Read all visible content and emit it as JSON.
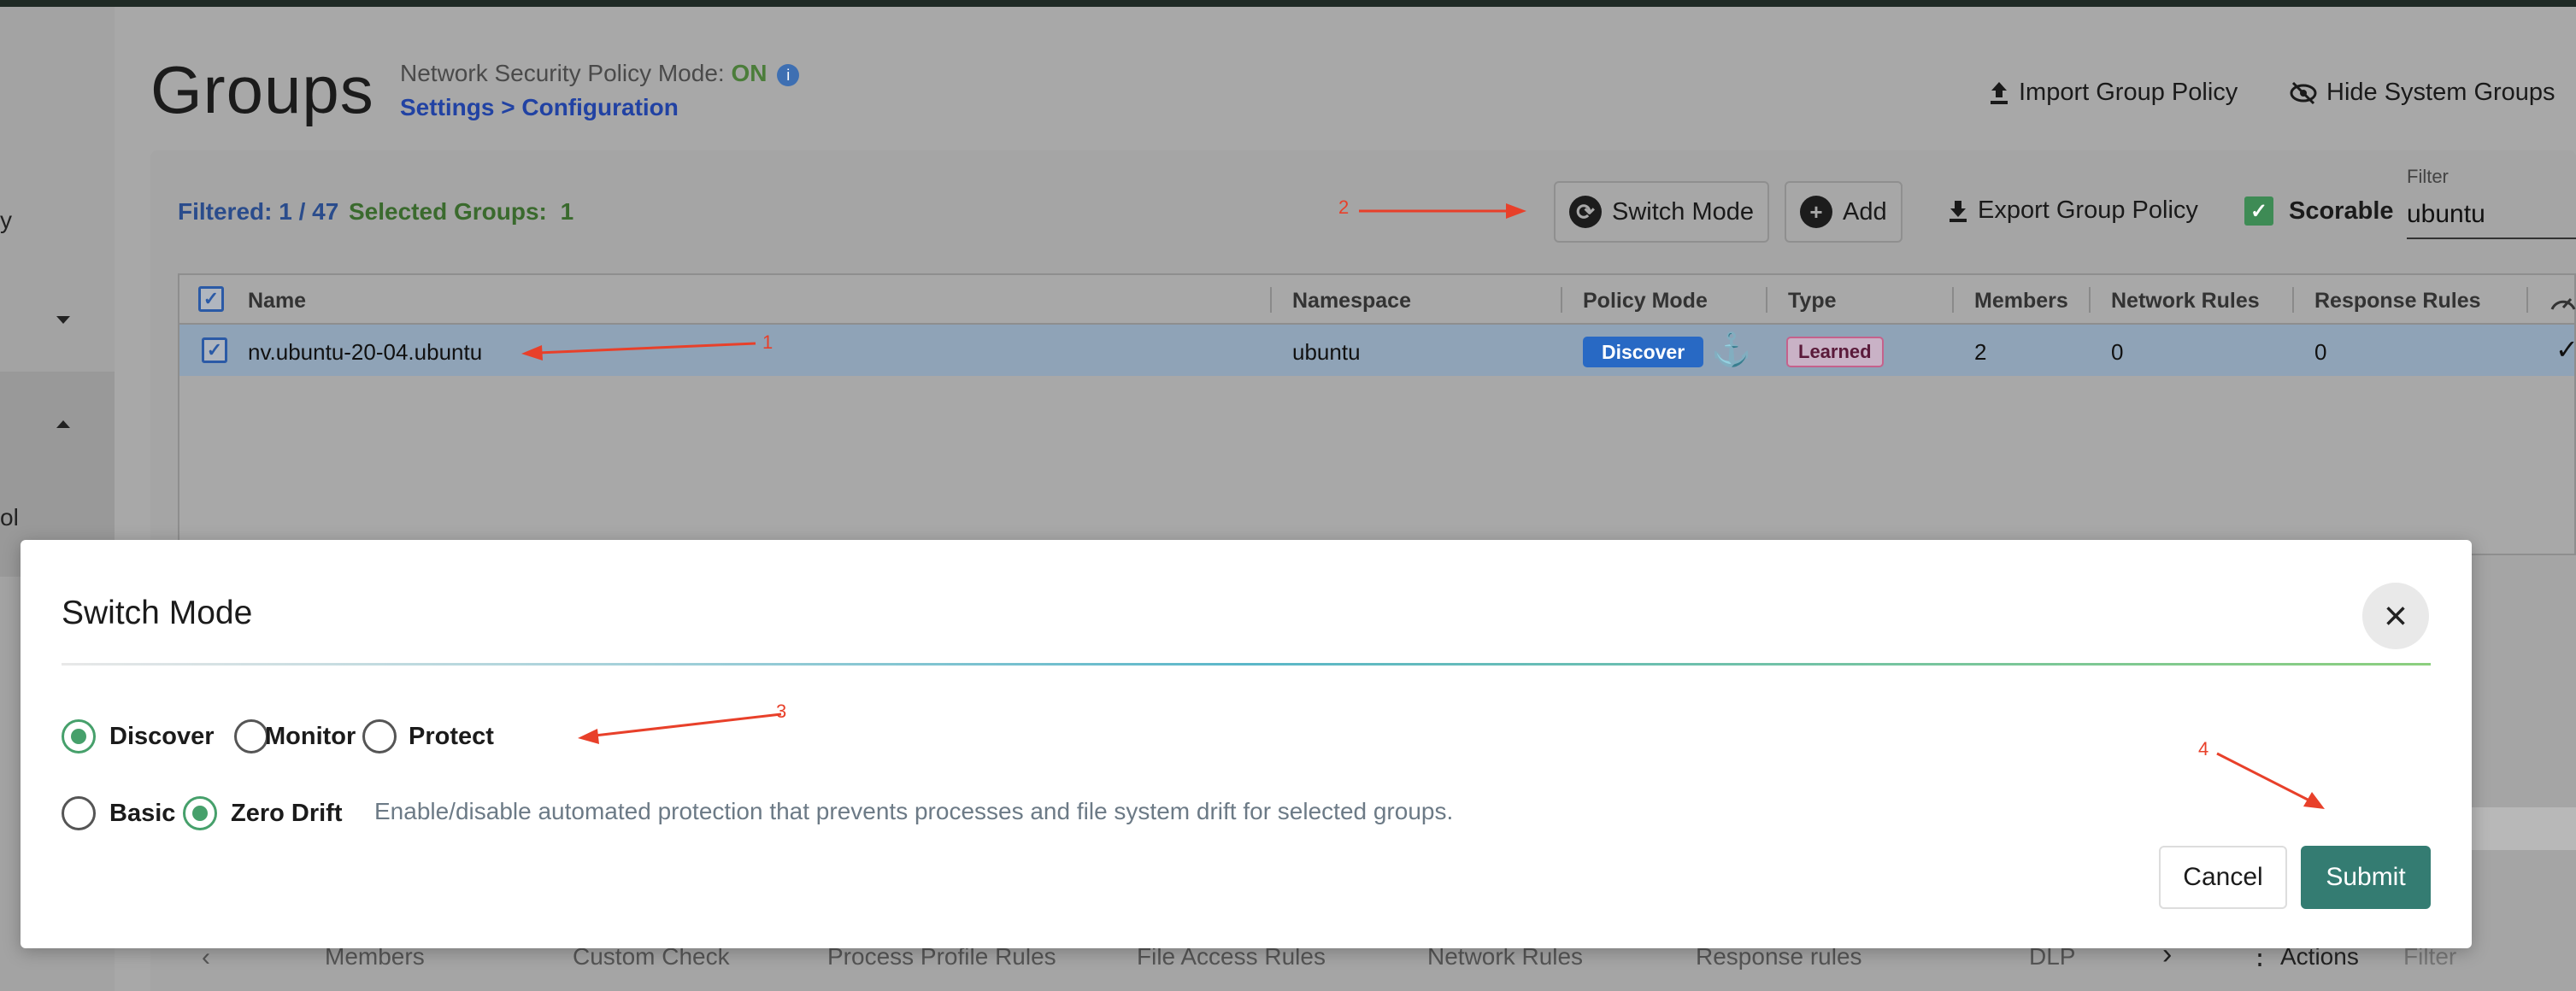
{
  "leftnav": {
    "fragments": [
      "y",
      "ol"
    ]
  },
  "page": {
    "title": "Groups",
    "mode_label": "Network Security Policy Mode:",
    "mode_value": "ON",
    "info_icon": "i",
    "settings_link": "Settings > Configuration",
    "import_label": "Import Group Policy",
    "hide_system_label": "Hide System Groups"
  },
  "toolbar": {
    "filtered_label": "Filtered: 1 / 47",
    "selected_label": "Selected Groups:",
    "selected_count": "1",
    "switch_mode_label": "Switch Mode",
    "add_label": "Add",
    "export_label": "Export Group Policy",
    "scorable_label": "Scorable",
    "filter_label": "Filter",
    "filter_value": "ubuntu"
  },
  "table": {
    "columns": [
      "Name",
      "Namespace",
      "Policy Mode",
      "Type",
      "Members",
      "Network Rules",
      "Response Rules"
    ],
    "rows": [
      {
        "name": "nv.ubuntu-20-04.ubuntu",
        "namespace": "ubuntu",
        "policy_mode": "Discover",
        "type": "Learned",
        "members": "2",
        "network_rules": "0",
        "response_rules": "0"
      }
    ]
  },
  "annotations": {
    "a1": "1",
    "a2": "2",
    "a3": "3",
    "a4": "4"
  },
  "modal": {
    "title": "Switch Mode",
    "modes": [
      "Discover",
      "Monitor",
      "Protect"
    ],
    "selected_mode": "Discover",
    "profiles": [
      "Basic",
      "Zero Drift"
    ],
    "selected_profile": "Zero Drift",
    "help_text": "Enable/disable automated protection that prevents processes and file system drift for selected groups.",
    "cancel_label": "Cancel",
    "submit_label": "Submit"
  },
  "bottom_tabs": [
    "Members",
    "Custom Check",
    "Process Profile Rules",
    "File Access Rules",
    "Network Rules",
    "Response rules",
    "DLP"
  ],
  "bottom_right": {
    "actions_label": "Actions",
    "filter_placeholder": "Filter"
  },
  "colors": {
    "accent_green": "#347c72",
    "radio_green": "#46a06b",
    "discover_blue": "#2869c4",
    "arrow_red": "#e8402a"
  }
}
